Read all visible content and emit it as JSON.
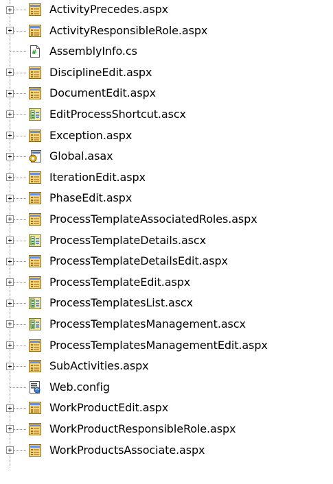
{
  "tree": {
    "items": [
      {
        "label": "ActivityPrecedes.aspx",
        "icon": "aspx-icon",
        "expandable": true
      },
      {
        "label": "ActivityResponsibleRole.aspx",
        "icon": "aspx-icon",
        "expandable": true
      },
      {
        "label": "AssemblyInfo.cs",
        "icon": "cs-icon",
        "expandable": false
      },
      {
        "label": "DisciplineEdit.aspx",
        "icon": "aspx-icon",
        "expandable": true
      },
      {
        "label": "DocumentEdit.aspx",
        "icon": "aspx-icon",
        "expandable": true
      },
      {
        "label": "EditProcessShortcut.ascx",
        "icon": "ascx-icon",
        "expandable": true
      },
      {
        "label": "Exception.aspx",
        "icon": "aspx-icon",
        "expandable": true
      },
      {
        "label": "Global.asax",
        "icon": "asax-icon",
        "expandable": true
      },
      {
        "label": "IterationEdit.aspx",
        "icon": "aspx-icon",
        "expandable": true
      },
      {
        "label": "PhaseEdit.aspx",
        "icon": "aspx-icon",
        "expandable": true
      },
      {
        "label": "ProcessTemplateAssociatedRoles.aspx",
        "icon": "aspx-icon",
        "expandable": true
      },
      {
        "label": "ProcessTemplateDetails.ascx",
        "icon": "ascx-icon",
        "expandable": true
      },
      {
        "label": "ProcessTemplateDetailsEdit.aspx",
        "icon": "aspx-icon",
        "expandable": true
      },
      {
        "label": "ProcessTemplateEdit.aspx",
        "icon": "aspx-icon",
        "expandable": true
      },
      {
        "label": "ProcessTemplatesList.ascx",
        "icon": "ascx-icon",
        "expandable": true
      },
      {
        "label": "ProcessTemplatesManagement.ascx",
        "icon": "ascx-icon",
        "expandable": true
      },
      {
        "label": "ProcessTemplatesManagementEdit.aspx",
        "icon": "aspx-icon",
        "expandable": true
      },
      {
        "label": "SubActivities.aspx",
        "icon": "aspx-icon",
        "expandable": true
      },
      {
        "label": "Web.config",
        "icon": "config-icon",
        "expandable": false
      },
      {
        "label": "WorkProductEdit.aspx",
        "icon": "aspx-icon",
        "expandable": true
      },
      {
        "label": "WorkProductResponsibleRole.aspx",
        "icon": "aspx-icon",
        "expandable": true
      },
      {
        "label": "WorkProductsAssociate.aspx",
        "icon": "aspx-icon",
        "expandable": true
      }
    ]
  }
}
